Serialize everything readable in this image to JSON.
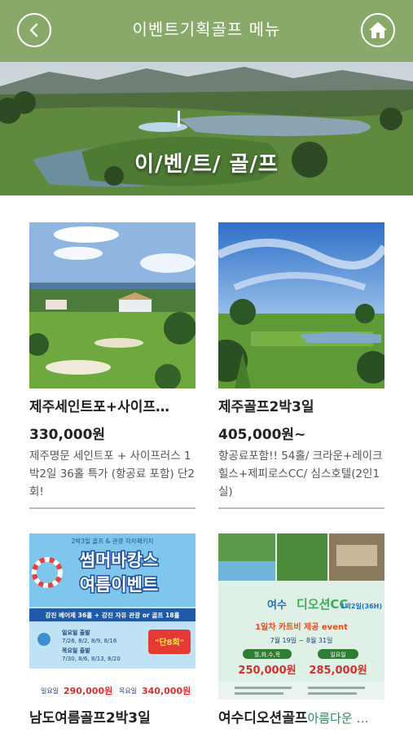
{
  "header": {
    "title": "이벤트기획골프 메뉴",
    "back_icon": "chevron-left-icon",
    "home_icon": "home-icon"
  },
  "banner": {
    "title": "이/벤/트/ 골/프"
  },
  "products": [
    {
      "name": "제주세인트포+사이프…",
      "price": "330,000원",
      "desc": "제주명문 세인트포 + 사이프러스 1박2일 36홀 특가 (항공료 포함) 단2회!"
    },
    {
      "name": "제주골프2박3일",
      "price": "405,000원~",
      "desc": "항공료포함!! 54홀/ 크라운+레이크힐스+제피로스CC/ 심스호텔(2인1실)"
    },
    {
      "name": "남도여름골프2박3일",
      "poster": {
        "top": "2박3일 골프 & 관광 자차패키지",
        "headline1": "썸머바캉스",
        "headline2": "여름이벤트",
        "line": "강진 베어제 36홀 + 강진 자유 관광 or 골프 18홀",
        "sun_dates": "7/26, 8/2, 8/9, 8/16",
        "wed_dates": "7/30, 8/6, 8/13, 8/20",
        "sun_label": "일요일 출발",
        "wed_label": "목요일 출발",
        "badge": "\"단8회\"",
        "price1_label": "일요일",
        "price1": "290,000원",
        "price2_label": "목요일",
        "price2": "340,000원"
      }
    },
    {
      "name": "여수디오션골프",
      "name_sub": "아름다운 …",
      "poster": {
        "title_prefix": "여수",
        "title_main": "디오션CC",
        "title_suffix": "1박2일(36H)",
        "event": "1일차 카트비 제공 event",
        "dates": "7월 19일 ~ 8월 31일",
        "label1": "월,화,수,목",
        "label2": "일요일",
        "price1": "250,000원",
        "price2": "285,000원"
      }
    }
  ]
}
